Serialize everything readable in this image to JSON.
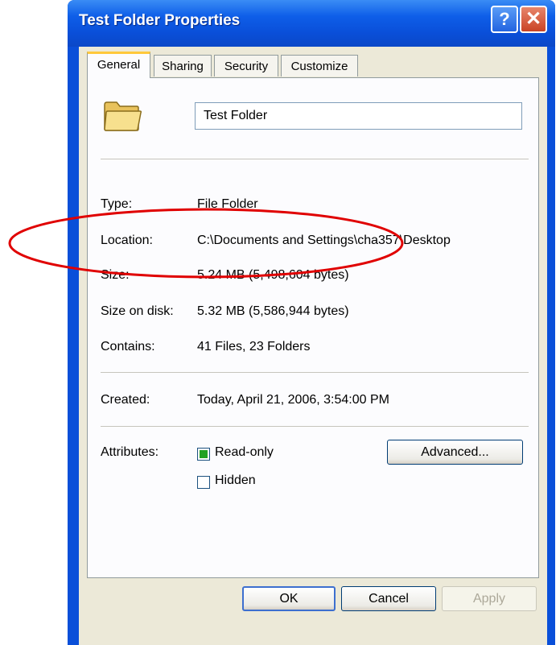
{
  "window": {
    "title": "Test Folder Properties",
    "help_symbol": "?",
    "close_symbol": "✕"
  },
  "tabs": [
    {
      "label": "General",
      "active": true
    },
    {
      "label": "Sharing",
      "active": false
    },
    {
      "label": "Security",
      "active": false
    },
    {
      "label": "Customize",
      "active": false
    }
  ],
  "general": {
    "folder_name": "Test Folder",
    "icon": "folder-icon",
    "type": {
      "label": "Type:",
      "value": "File Folder"
    },
    "location": {
      "label": "Location:",
      "value": "C:\\Documents and Settings\\cha357\\Desktop"
    },
    "size": {
      "label": "Size:",
      "value": "5.24 MB (5,498,604 bytes)"
    },
    "size_on_disk": {
      "label": "Size on disk:",
      "value": "5.32 MB (5,586,944 bytes)"
    },
    "contains": {
      "label": "Contains:",
      "value": "41 Files, 23 Folders"
    },
    "created": {
      "label": "Created:",
      "value": "Today, April 21, 2006, 3:54:00 PM"
    },
    "attributes": {
      "label": "Attributes:",
      "read_only": {
        "label": "Read-only",
        "state": "indeterminate"
      },
      "hidden": {
        "label": "Hidden",
        "state": "unchecked"
      },
      "advanced_label": "Advanced..."
    }
  },
  "buttons": {
    "ok": "OK",
    "cancel": "Cancel",
    "apply": "Apply"
  },
  "colors": {
    "titlebar": "#0a4fd9",
    "client": "#ece9d8",
    "annotation": "#e00000"
  }
}
